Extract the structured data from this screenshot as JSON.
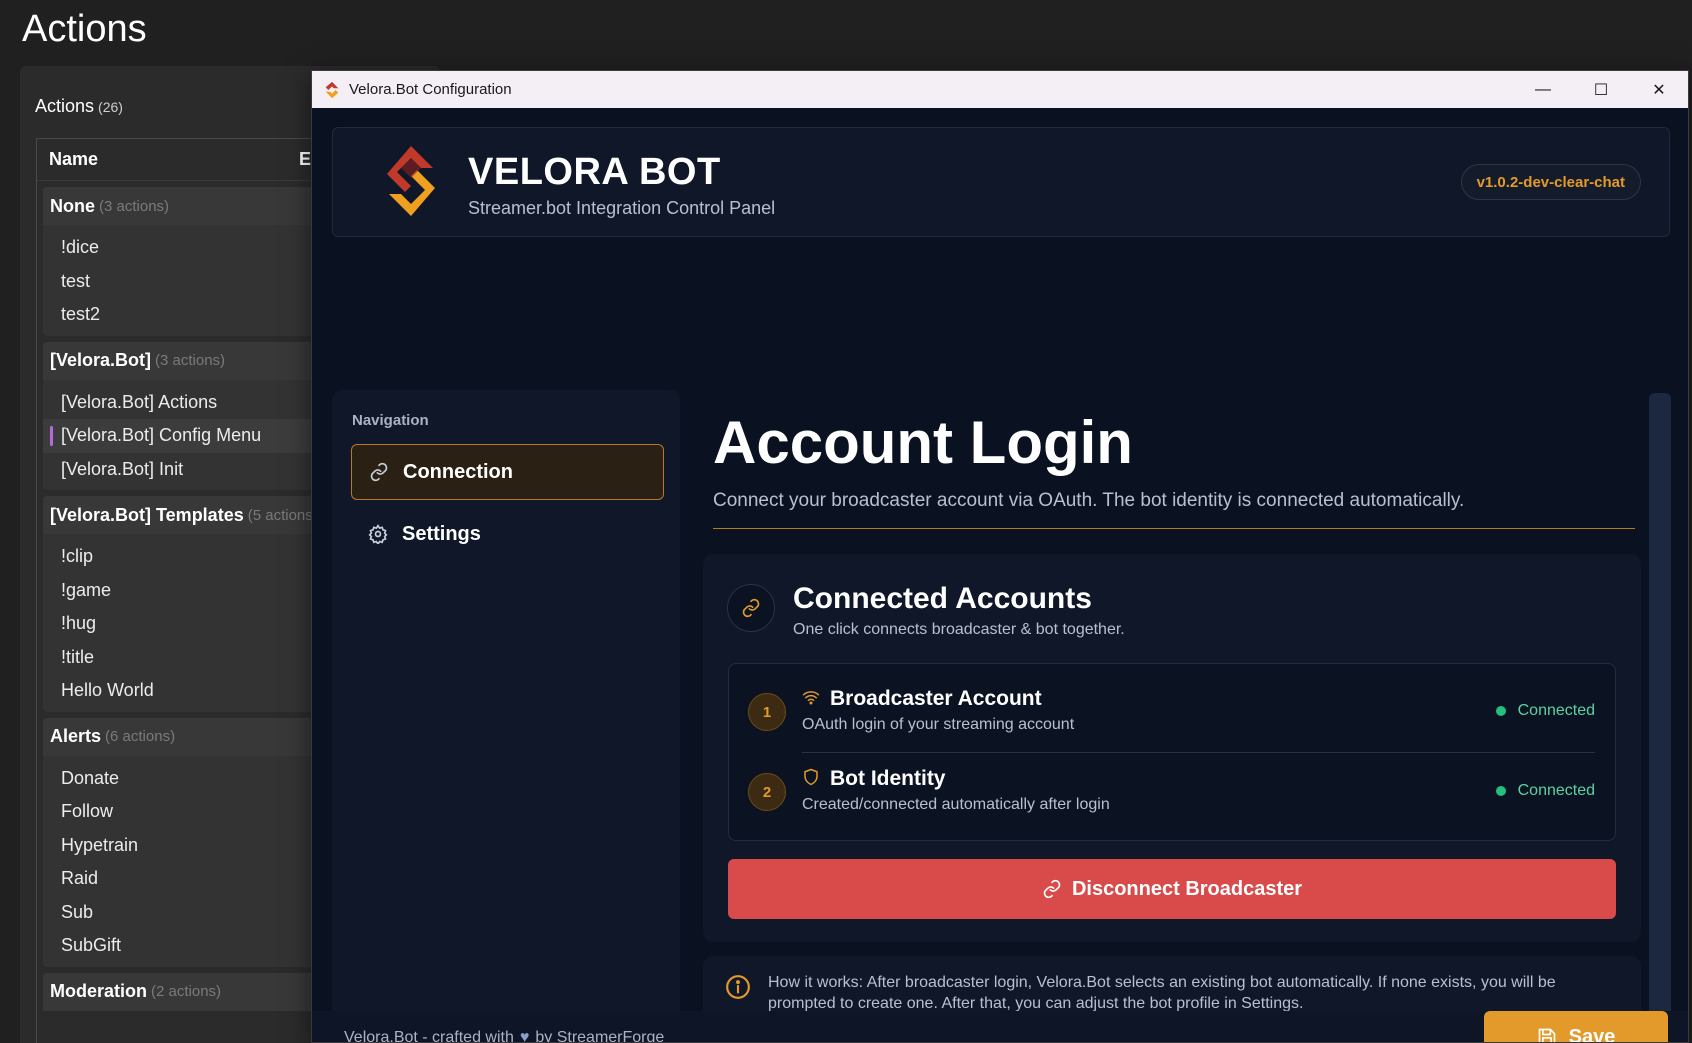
{
  "host": {
    "title": "Actions",
    "panel_title": "Actions",
    "panel_count": "(26)",
    "col_name": "Name",
    "col_second": "E",
    "groups": [
      {
        "name": "None",
        "count": "(3 actions)",
        "items": [
          "!dice",
          "test",
          "test2"
        ]
      },
      {
        "name": "[Velora.Bot]",
        "count": "(3 actions)",
        "items": [
          "[Velora.Bot] Actions",
          "[Velora.Bot] Config Menu",
          "[Velora.Bot] Init"
        ]
      },
      {
        "name": "[Velora.Bot] Templates",
        "count": "(5 actions)",
        "items": [
          "!clip",
          "!game",
          "!hug",
          "!title",
          "Hello World"
        ]
      },
      {
        "name": "Alerts",
        "count": "(6 actions)",
        "items": [
          "Donate",
          "Follow",
          "Hypetrain",
          "Raid",
          "Sub",
          "SubGift"
        ]
      },
      {
        "name": "Moderation",
        "count": "(2 actions)",
        "items": []
      }
    ]
  },
  "window": {
    "title": "Velora.Bot Configuration",
    "minimize_glyph": "—",
    "maximize_glyph": "☐",
    "close_glyph": "✕"
  },
  "header": {
    "brand_title": "VELORA BOT",
    "brand_subtitle": "Streamer.bot Integration Control Panel",
    "version": "v1.0.2-dev-clear-chat"
  },
  "nav": {
    "label": "Navigation",
    "items": [
      {
        "label": "Connection",
        "icon": "link-icon"
      },
      {
        "label": "Settings",
        "icon": "gear-icon"
      }
    ]
  },
  "main": {
    "title": "Account Login",
    "description": "Connect your broadcaster account via OAuth. The bot identity is connected automatically.",
    "accounts_card": {
      "title": "Connected Accounts",
      "subtitle": "One click connects broadcaster & bot together.",
      "rows": [
        {
          "step": "1",
          "icon": "wifi-icon",
          "title": "Broadcaster Account",
          "subtitle": "OAuth login of your streaming account",
          "status": "Connected"
        },
        {
          "step": "2",
          "icon": "shield-icon",
          "title": "Bot Identity",
          "subtitle": "Created/connected automatically after login",
          "status": "Connected"
        }
      ],
      "disconnect_label": "Disconnect Broadcaster"
    },
    "info": "How it works: After broadcaster login, Velora.Bot selects an existing bot automatically. If none exists, you will be prompted to create one. After that, you can adjust the bot profile in Settings."
  },
  "footer": {
    "prefix": "Velora.Bot - crafted with",
    "heart": "♥",
    "suffix": "by StreamerForge",
    "save_label": "Save"
  },
  "colors": {
    "accent": "#e39a2b",
    "danger": "#d94a4a",
    "success": "#22c07a",
    "background": "#0a1120"
  }
}
